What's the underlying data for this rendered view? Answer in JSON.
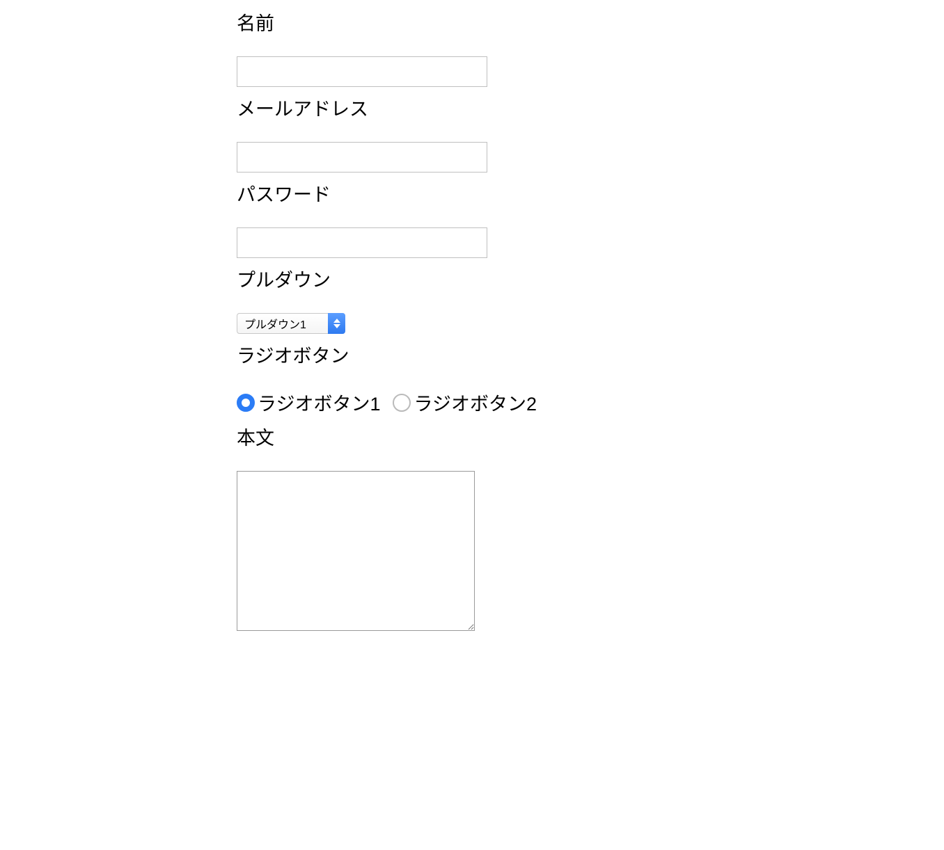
{
  "form": {
    "name": {
      "label": "名前",
      "value": ""
    },
    "email": {
      "label": "メールアドレス",
      "value": ""
    },
    "password": {
      "label": "パスワード",
      "value": ""
    },
    "pulldown": {
      "label": "プルダウン",
      "selected": "プルダウン1"
    },
    "radio": {
      "label": "ラジオボタン",
      "options": [
        {
          "label": "ラジオボタン1",
          "checked": true
        },
        {
          "label": "ラジオボタン2",
          "checked": false
        }
      ]
    },
    "body": {
      "label": "本文",
      "value": ""
    }
  }
}
